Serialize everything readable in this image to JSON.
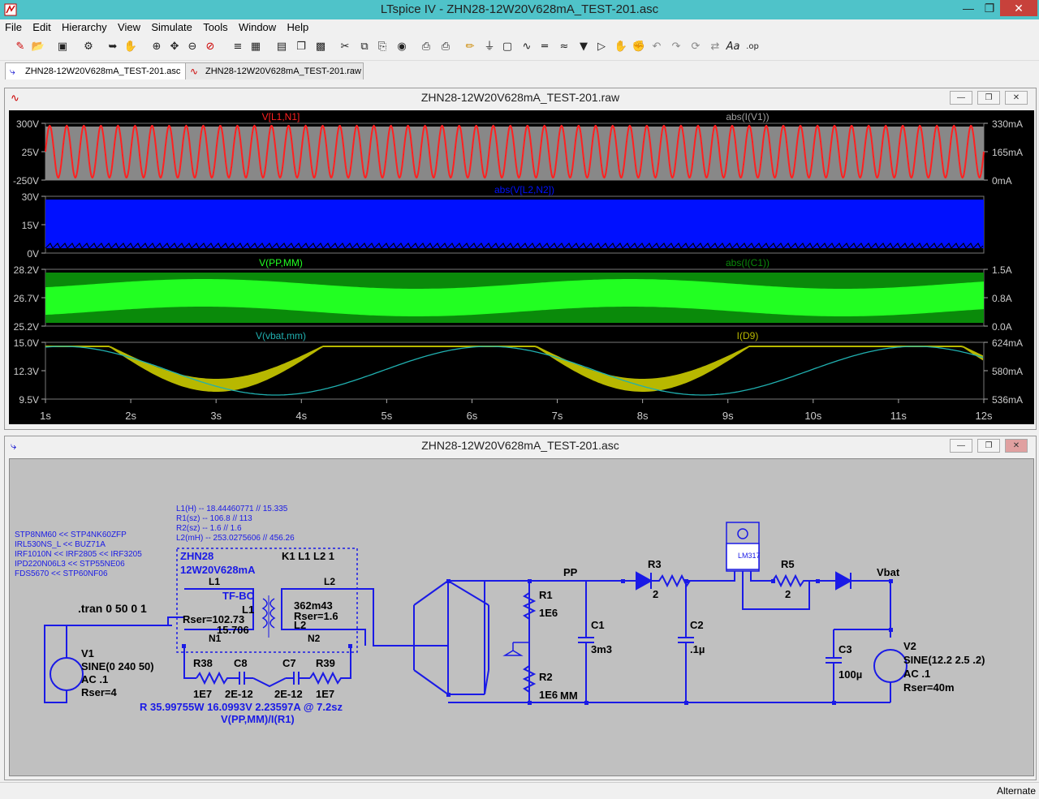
{
  "window": {
    "title": "LTspice IV - ZHN28-12W20V628mA_TEST-201.asc"
  },
  "menu": [
    "File",
    "Edit",
    "Hierarchy",
    "View",
    "Simulate",
    "Tools",
    "Window",
    "Help"
  ],
  "tabs": [
    {
      "label": "ZHN28-12W20V628mA_TEST-201.asc",
      "icon": "schematic-icon",
      "active": true
    },
    {
      "label": "ZHN28-12W20V628mA_TEST-201.raw",
      "icon": "waveform-icon",
      "active": false
    }
  ],
  "waveform_window": {
    "title": "ZHN28-12W20V628mA_TEST-201.raw"
  },
  "schematic_window": {
    "title": "ZHN28-12W20V628mA_TEST-201.asc"
  },
  "colors": {
    "red": "#ff2020",
    "gray": "#a0a0a0",
    "blue": "#0010ff",
    "lightgreen": "#22ff22",
    "darkgreen": "#0a8a0a",
    "cyan": "#20b0b0",
    "olive": "#b8b800",
    "schematic_blue": "#1a1ae6",
    "schematic_bg": "#c0c0c0"
  },
  "chart_data": [
    {
      "type": "line",
      "title": "",
      "series": [
        {
          "name": "V[L1,N1]"
        },
        {
          "name": "abs(I(V1))"
        }
      ],
      "left_ticks": [
        "300V",
        "25V",
        "-250V"
      ],
      "right_ticks": [
        "330mA",
        "165mA",
        "0mA"
      ]
    },
    {
      "type": "line",
      "title": "",
      "series": [
        {
          "name": "abs(V[L2,N2])"
        }
      ],
      "left_ticks": [
        "30V",
        "15V",
        "0V"
      ]
    },
    {
      "type": "line",
      "title": "",
      "series": [
        {
          "name": "V(PP,MM)"
        },
        {
          "name": "abs(I(C1))"
        }
      ],
      "left_ticks": [
        "28.2V",
        "26.7V",
        "25.2V"
      ],
      "right_ticks": [
        "1.5A",
        "0.8A",
        "0.0A"
      ]
    },
    {
      "type": "line",
      "title": "",
      "series": [
        {
          "name": "V(vbat,mm)"
        },
        {
          "name": "I(D9)"
        }
      ],
      "left_ticks": [
        "15.0V",
        "12.3V",
        "9.5V"
      ],
      "right_ticks": [
        "624mA",
        "580mA",
        "536mA"
      ],
      "x": [
        "1s",
        "2s",
        "3s",
        "4s",
        "5s",
        "6s",
        "7s",
        "8s",
        "9s",
        "10s",
        "11s",
        "12s"
      ]
    }
  ],
  "schematic": {
    "mosfet_list": [
      "STP8NM60 << STP4NK60ZFP",
      "IRL530NS_L << BUZ71A",
      "IRF1010N << IRF2805 << IRF3205",
      "IPD220N06L3 << STP55NE06",
      "FDS5670 << STP60NF06"
    ],
    "params": [
      "L1(H) -- 18.44460771 // 15.335",
      "R1(sz) -- 106.8 // 113",
      "R2(sz) -- 1.6 // 1.6",
      "L2(mH) -- 253.0275606 // 456.26"
    ],
    "tran": ".tran 0 50 0 1",
    "transformer": {
      "name": "ZHN28",
      "part": "12W20V628mA",
      "coupling": "K1 L1 L2 1",
      "l1": "L1",
      "l2": "L2",
      "type": "TF-BC",
      "l1_label": "L1",
      "l2_label": "L2",
      "rser1": "Rser=102.73",
      "l1_val": "15.706",
      "l2_val": "362m43",
      "rser2": "Rser=1.6",
      "n1": "N1",
      "n2": "N2"
    },
    "v1": {
      "name": "V1",
      "value": "SINE(0 240 50)",
      "ac": "AC .1",
      "rser": "Rser=4"
    },
    "r38": {
      "name": "R38",
      "value": "1E7"
    },
    "c8": {
      "name": "C8",
      "value": "2E-12"
    },
    "c7": {
      "name": "C7",
      "value": "2E-12"
    },
    "r39": {
      "name": "R39",
      "value": "1E7"
    },
    "note1": "R 35.99755W 16.0993V 2.23597A  @ 7.2sz",
    "note2": "V(PP,MM)/I(R1)",
    "pp": "PP",
    "mm": "MM",
    "vbat": "Vbat",
    "r1": {
      "name": "R1",
      "value": "1E6"
    },
    "r2": {
      "name": "R2",
      "value": "1E6"
    },
    "r3": {
      "name": "R3",
      "value": "2"
    },
    "r5": {
      "name": "R5",
      "value": "2"
    },
    "c1": {
      "name": "C1",
      "value": "3m3"
    },
    "c2": {
      "name": "C2",
      "value": ".1µ"
    },
    "c3": {
      "name": "C3",
      "value": "100µ"
    },
    "reg": "LM317",
    "v2": {
      "name": "V2",
      "value": "SINE(12.2 2.5 .2)",
      "ac": "AC .1",
      "rser": "Rser=40m"
    }
  },
  "status": "Alternate"
}
